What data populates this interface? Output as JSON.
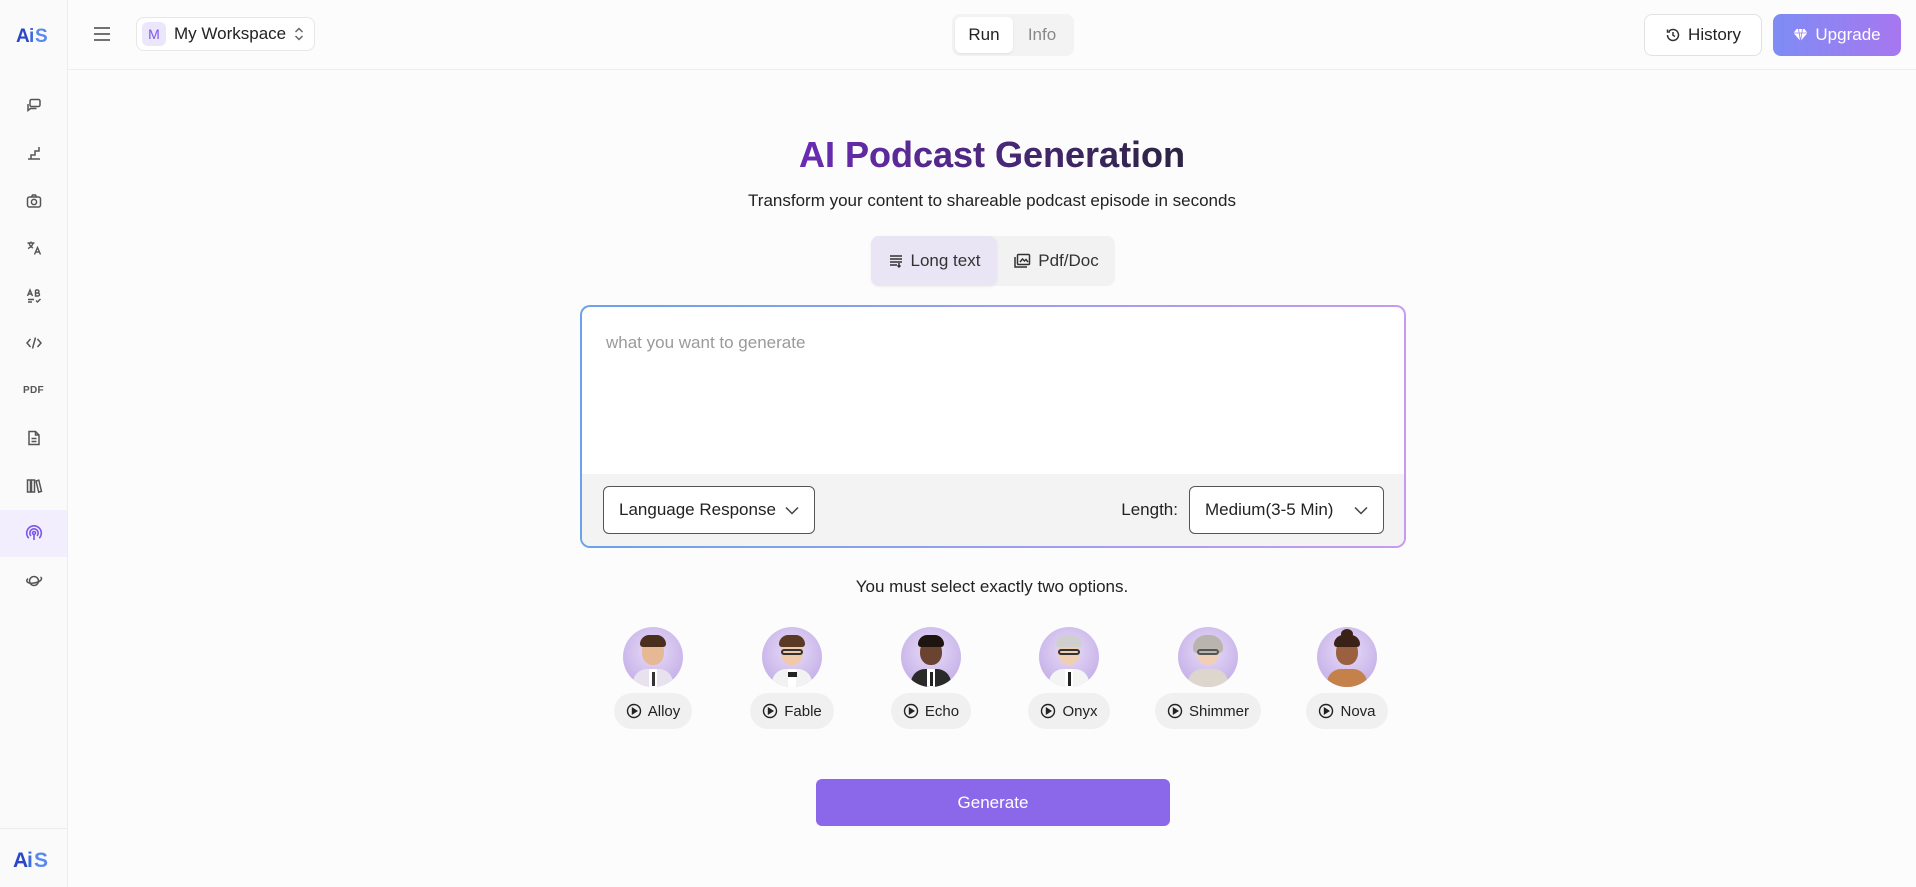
{
  "brand": {
    "logo_text": "AiS"
  },
  "header": {
    "workspace": {
      "avatar_letter": "M",
      "name": "My Workspace"
    },
    "tabs": [
      {
        "label": "Run",
        "active": true
      },
      {
        "label": "Info",
        "active": false
      }
    ],
    "history_label": "History",
    "upgrade_label": "Upgrade"
  },
  "sidebar": {
    "items": [
      {
        "icon": "chat-icon"
      },
      {
        "icon": "stairs-icon"
      },
      {
        "icon": "camera-icon"
      },
      {
        "icon": "translate-icon"
      },
      {
        "icon": "grammar-check-icon"
      },
      {
        "icon": "code-icon"
      },
      {
        "icon": "pdf-icon",
        "label": "PDF"
      },
      {
        "icon": "document-icon"
      },
      {
        "icon": "books-icon"
      },
      {
        "icon": "podcast-icon",
        "active": true
      },
      {
        "icon": "planet-icon"
      }
    ]
  },
  "main": {
    "title": "AI Podcast Generation",
    "subtitle": "Transform your content to shareable podcast episode in seconds",
    "modes": [
      {
        "label": "Long text",
        "active": true
      },
      {
        "label": "Pdf/Doc",
        "active": false
      }
    ],
    "input_placeholder": "what you want to generate",
    "language_select": "Language Response",
    "length_label": "Length:",
    "length_select": "Medium(3-5 Min)",
    "hint": "You must select exactly two options.",
    "voices": [
      "Alloy",
      "Fable",
      "Echo",
      "Onyx",
      "Shimmer",
      "Nova"
    ],
    "generate_label": "Generate"
  },
  "colors": {
    "accent": "#8b67ea",
    "upgrade_gradient_start": "#7e8cf4",
    "upgrade_gradient_end": "#a777f0",
    "title_purple": "#6a2bb4"
  }
}
